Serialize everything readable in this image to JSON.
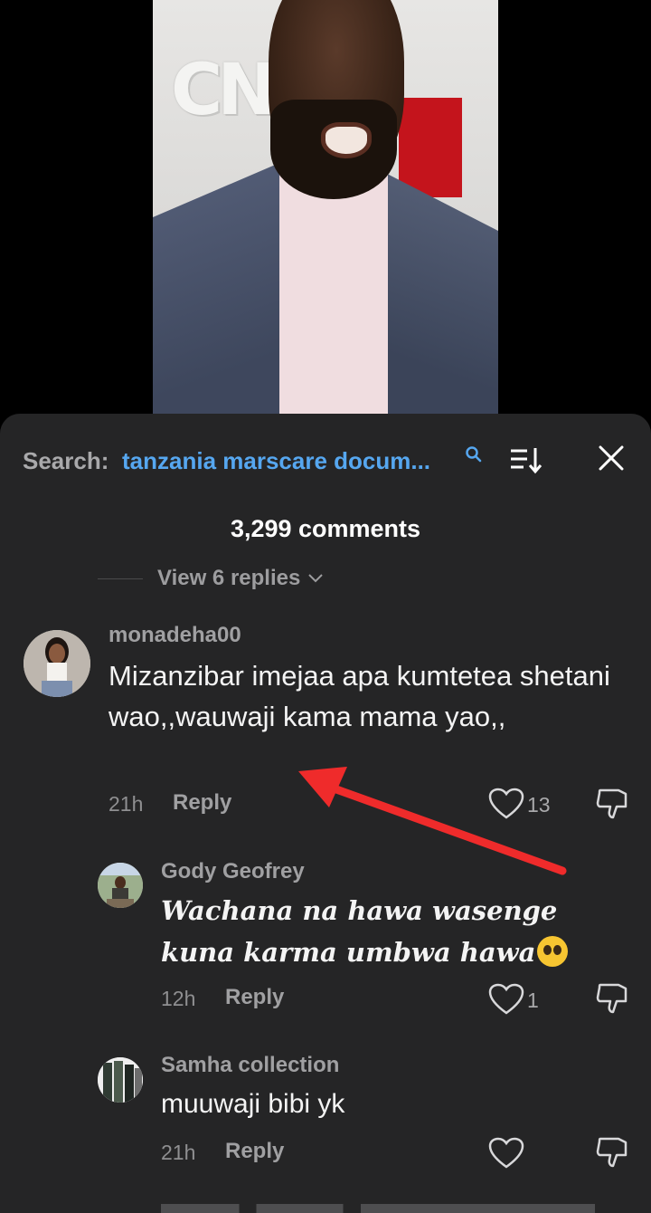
{
  "video": {
    "wall_text": "CNN"
  },
  "sheet": {
    "search_prefix": "Search:",
    "search_query": "tanzania marscare docum...",
    "comment_count": "3,299 comments",
    "view_replies_label": "View 6 replies",
    "icons": [
      "search-icon",
      "sort-icon",
      "close-icon",
      "chevron-down-icon",
      "heart-icon",
      "dislike-icon"
    ],
    "colors": {
      "sheet_bg": "#252526",
      "link_blue": "#56a7f0",
      "arrow_red": "#ef2b2b"
    }
  },
  "comments": [
    {
      "username": "monadeha00",
      "text": "Mizanzibar imejaa apa kumtetea shetani wao,,wauwaji kama mama yao,,",
      "time": "21h",
      "reply_label": "Reply",
      "likes": "13"
    },
    {
      "username": "Gody Geofrey",
      "text": "Wachana na hawa wasenge kuna karma umbwa hawa",
      "emoji": "pleading-face-emoji",
      "time": "12h",
      "reply_label": "Reply",
      "likes": "1"
    },
    {
      "username": "Samha collection",
      "text": "muuwaji bibi yk",
      "time": "21h",
      "reply_label": "Reply",
      "likes": ""
    }
  ]
}
